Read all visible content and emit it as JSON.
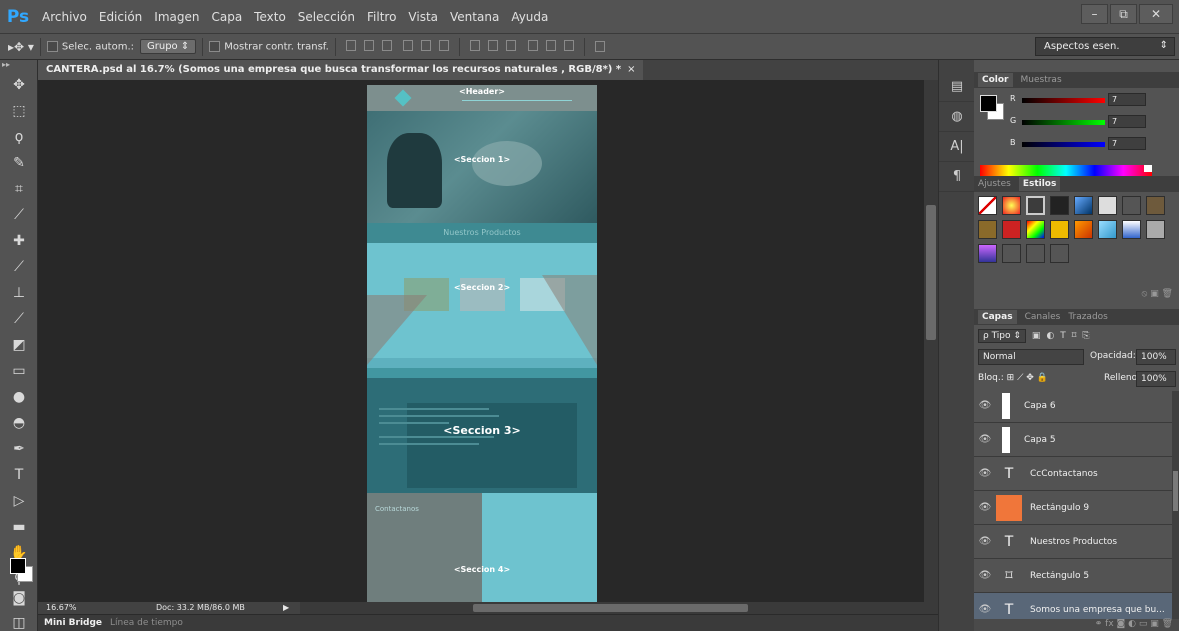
{
  "app": {
    "logo": "Ps"
  },
  "menu": [
    "Archivo",
    "Edición",
    "Imagen",
    "Capa",
    "Texto",
    "Selección",
    "Filtro",
    "Vista",
    "Ventana",
    "Ayuda"
  ],
  "window_controls": {
    "minimize": "–",
    "restore": "⧉",
    "close": "✕"
  },
  "options": {
    "tool_icon": "move-tool-icon",
    "auto_select_label": "Selec. autom.:",
    "auto_select_value": "Grupo",
    "transform_label": "Mostrar contr. transf.",
    "workspace": "Aspectos esen."
  },
  "document": {
    "tab_title": "CANTERA.psd al 16.7% (Somos una empresa que busca transformar los recursos naturales , RGB/8*) *",
    "close_glyph": "×",
    "slices": {
      "header": "<Header>",
      "sec1": "<Seccion 1>",
      "products_bar": "Nuestros Productos",
      "sec2": "<Seccion 2>",
      "sec3": "<Seccion 3>",
      "sec4_title": "Contactanos",
      "sec4": "<Seccion 4>"
    }
  },
  "status": {
    "zoom": "16.67%",
    "doc_size": "Doc: 33.2 MB/86.0 MB",
    "arrow": "▶"
  },
  "bottom_tabs": [
    "Mini Bridge",
    "Línea de tiempo"
  ],
  "color_panel": {
    "tabs": [
      "Color",
      "Muestras"
    ],
    "channels": [
      {
        "label": "R",
        "value": "7",
        "color": "#ff0000"
      },
      {
        "label": "G",
        "value": "7",
        "color": "#00ff00"
      },
      {
        "label": "B",
        "value": "7",
        "color": "#0000ff"
      }
    ]
  },
  "styles_panel": {
    "tabs": [
      "Ajustes",
      "Estilos"
    ]
  },
  "layers_panel": {
    "tabs": [
      "Capas",
      "Canales",
      "Trazados"
    ],
    "kind_filter": "ρ Tipo",
    "blend_mode": "Normal",
    "opacity_label": "Opacidad:",
    "opacity_value": "100%",
    "lock_label": "Bloq.:",
    "fill_label": "Relleno:",
    "fill_value": "100%",
    "layers": [
      {
        "name": "Capa 6",
        "type": "pixel",
        "selected": false
      },
      {
        "name": "Capa 5",
        "type": "pixel",
        "selected": false
      },
      {
        "name": "CcContactanos",
        "type": "text",
        "selected": false
      },
      {
        "name": "Rectángulo 9",
        "type": "shape",
        "selected": false
      },
      {
        "name": "Nuestros Productos",
        "type": "text",
        "selected": false
      },
      {
        "name": "Rectángulo 5",
        "type": "shape-empty",
        "selected": false
      },
      {
        "name": "Somos una empresa que bu...",
        "type": "text",
        "selected": true
      }
    ]
  }
}
